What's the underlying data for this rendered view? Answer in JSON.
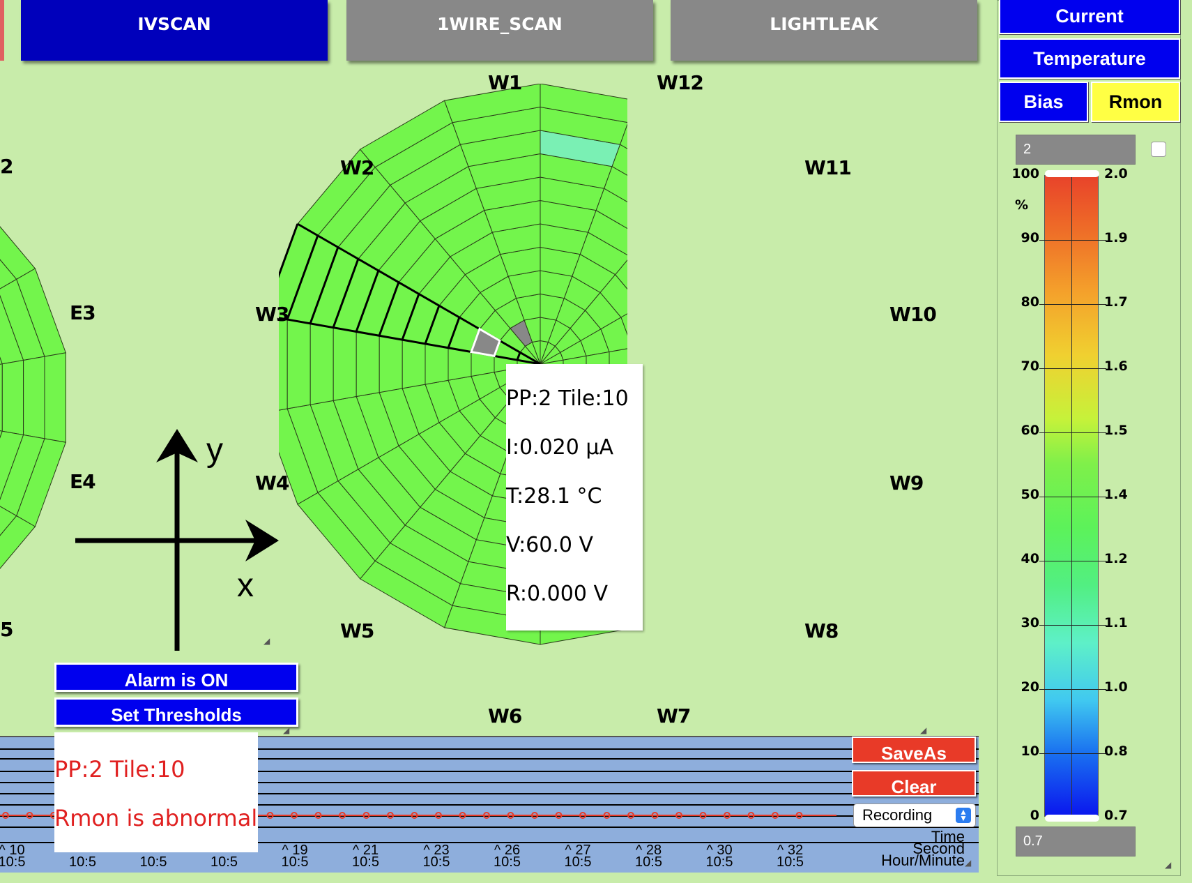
{
  "top_buttons": {
    "ivscan": "IVSCAN",
    "onewire_scan": "1WIRE_SCAN",
    "lightleak": "LIGHTLEAK"
  },
  "right_panel": {
    "current": "Current",
    "temperature": "Temperature",
    "bias": "Bias",
    "rmon": "Rmon",
    "scale_max": "2",
    "scale_min": "0.7",
    "percent_unit": "%",
    "percent_labels": [
      "100",
      "90",
      "80",
      "70",
      "60",
      "50",
      "40",
      "30",
      "20",
      "10",
      "0"
    ],
    "value_labels": [
      "2.0",
      "1.9",
      "1.7",
      "1.6",
      "1.5",
      "1.4",
      "1.2",
      "1.1",
      "1.0",
      "0.8",
      "0.7"
    ]
  },
  "map": {
    "west_labels": [
      "W1",
      "W2",
      "W3",
      "W4",
      "W5",
      "W6",
      "W7",
      "W8",
      "W9",
      "W10",
      "W11",
      "W12"
    ],
    "east_labels": {
      "e2": "2",
      "e3": "E3",
      "e4": "E4",
      "e5": "5"
    },
    "axes": {
      "x": "x",
      "y": "y"
    },
    "selected": {
      "pp": 2,
      "tile": 10
    }
  },
  "tooltip": {
    "line1": "PP:2 Tile:10",
    "line2": "I:0.020 μA",
    "line3": "T:28.1 °C",
    "line4": "V:60.0 V",
    "line5": "R:0.000 V"
  },
  "controls": {
    "alarm": "Alarm is ON",
    "thresholds": "Set Thresholds"
  },
  "alert": {
    "line1": "PP:2 Tile:10",
    "line2": "Rmon is abnormal"
  },
  "timeline": {
    "save_as": "SaveAs",
    "clear": "Clear",
    "mode": "Recording",
    "axis_time": "Time",
    "axis_second": "Second",
    "axis_hour_minute": "Hour/Minute",
    "ticks": [
      {
        "sec": "^ 10",
        "hm": "10:5"
      },
      {
        "sec": "",
        "hm": "10:5"
      },
      {
        "sec": "",
        "hm": "10:5"
      },
      {
        "sec": "",
        "hm": "10:5"
      },
      {
        "sec": "^ 19",
        "hm": "10:5"
      },
      {
        "sec": "^ 21",
        "hm": "10:5"
      },
      {
        "sec": "^ 23",
        "hm": "10:5"
      },
      {
        "sec": "^ 26",
        "hm": "10:5"
      },
      {
        "sec": "^ 27",
        "hm": "10:5"
      },
      {
        "sec": "^ 28",
        "hm": "10:5"
      },
      {
        "sec": "^ 30",
        "hm": "10:5"
      },
      {
        "sec": "^ 32",
        "hm": "10:5"
      }
    ],
    "series_color": "#e83a28"
  },
  "colors": {
    "background": "#c8ecaa",
    "tile_green": "#73f54c",
    "tile_cyan": "#7af0b4",
    "tile_gray": "#888888",
    "button_blue": "#0000ee",
    "button_gray": "#888888",
    "button_red": "#e83a28",
    "button_yellow": "#ffff44"
  }
}
